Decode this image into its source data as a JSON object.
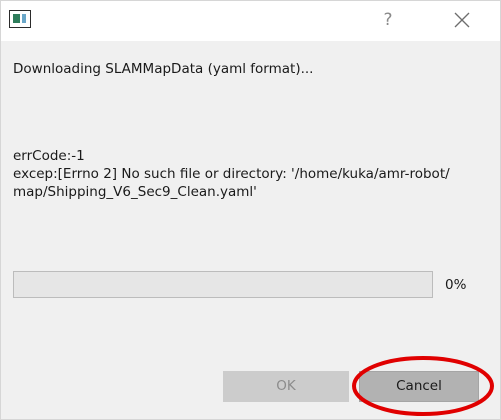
{
  "window": {
    "icon": "app-window-icon",
    "help_glyph": "?",
    "close_icon": "close-icon"
  },
  "message": "Downloading SLAMMapData (yaml format)...",
  "error": {
    "code_line": "errCode:-1",
    "except_line1": "excep:[Errno 2] No such file or directory: '/home/kuka/amr-robot/",
    "except_line2": "map/Shipping_V6_Sec9_Clean.yaml'"
  },
  "progress": {
    "value": 0,
    "label": "0%",
    "fill_color": "#06b025"
  },
  "buttons": {
    "ok_label": "OK",
    "ok_enabled": false,
    "cancel_label": "Cancel"
  },
  "annotation": {
    "ring_color": "#e00000",
    "target": "cancel-button"
  }
}
